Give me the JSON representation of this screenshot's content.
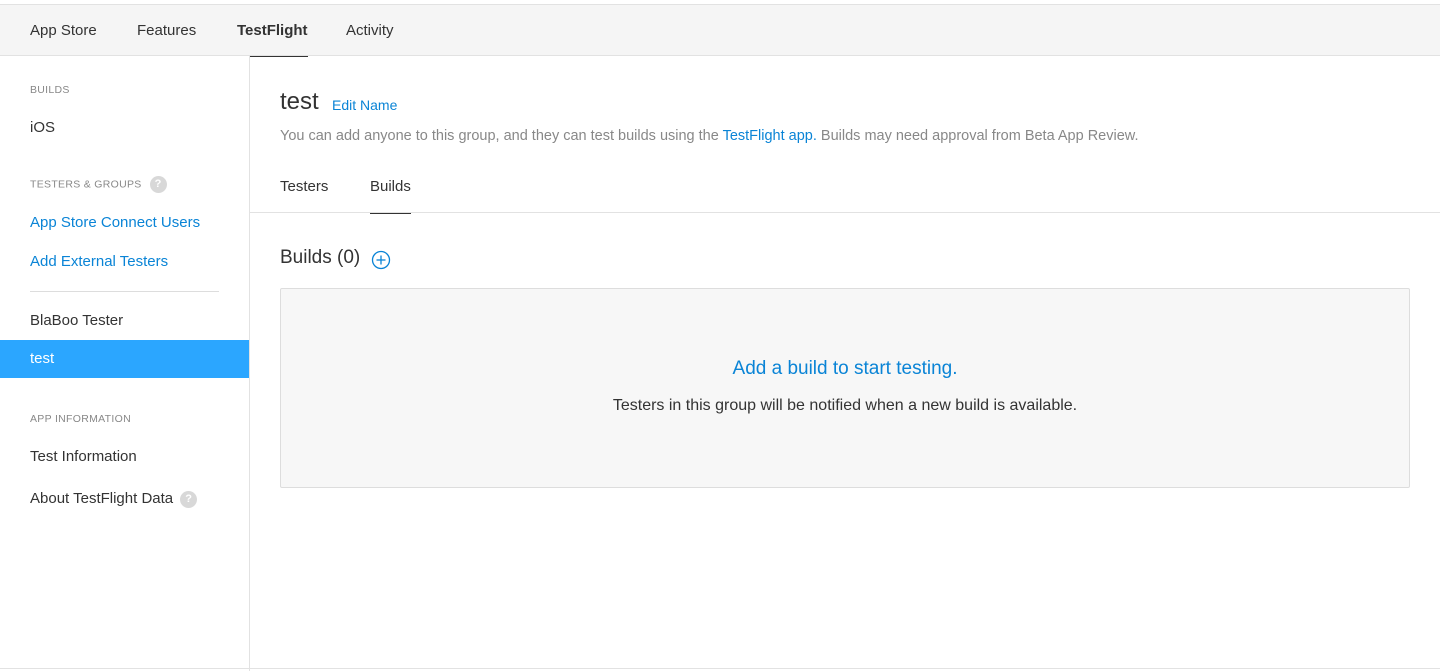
{
  "topnav": {
    "tabs": [
      {
        "label": "App Store"
      },
      {
        "label": "Features"
      },
      {
        "label": "TestFlight"
      },
      {
        "label": "Activity"
      }
    ],
    "active_tab": "TestFlight"
  },
  "sidebar": {
    "builds_heading": "BUILDS",
    "ios_label": "iOS",
    "testers_heading": "TESTERS & GROUPS",
    "help_glyph": "?",
    "app_store_connect_users": "App Store Connect Users",
    "add_external_testers": "Add External Testers",
    "group_blaboo": "BlaBoo Tester",
    "group_test": "test",
    "app_info_heading": "APP INFORMATION",
    "test_information": "Test Information",
    "about_testflight_data": "About TestFlight Data"
  },
  "main": {
    "group_name": "test",
    "edit_name": "Edit Name",
    "description_before": "You can add anyone to this group, and they can test builds using the ",
    "description_link": "TestFlight app.",
    "description_after": " Builds may need approval from Beta App Review.",
    "subtabs": [
      {
        "label": "Testers"
      },
      {
        "label": "Builds"
      }
    ],
    "active_subtab": "Builds",
    "builds_heading": "Builds (0)",
    "empty_title": "Add a build to start testing.",
    "empty_subtitle": "Testers in this group will be notified when a new build is available."
  },
  "colors": {
    "accent": "#0a84d6",
    "selected_bg": "#2ba6ff",
    "topnav_bg": "#f5f5f5"
  },
  "icons": {
    "add_build": "plus-circle-icon",
    "help": "question-badge-icon"
  }
}
